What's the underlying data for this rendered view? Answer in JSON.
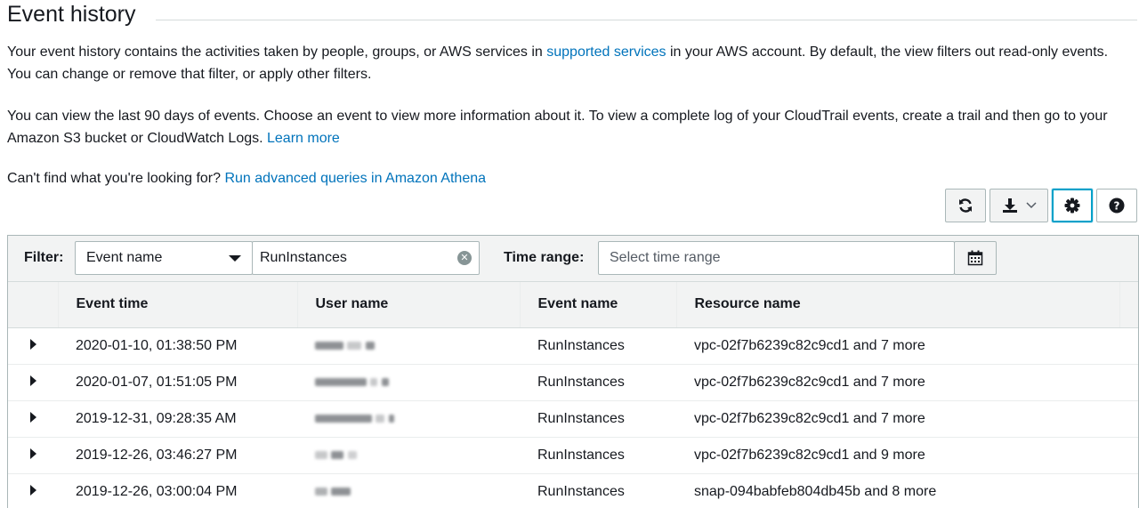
{
  "page": {
    "title": "Event history"
  },
  "intro": {
    "p1_a": "Your event history contains the activities taken by people, groups, or AWS services in ",
    "p1_link": "supported services",
    "p1_b": " in your AWS account. By default, the view filters out read-only events. You can change or remove that filter, or apply other filters.",
    "p2_a": "You can view the last 90 days of events. Choose an event to view more information about it. To view a complete log of your CloudTrail events, create a trail and then go to your Amazon S3 bucket or CloudWatch Logs. ",
    "p2_link": "Learn more",
    "p3_a": "Can't find what you're looking for? ",
    "p3_link": "Run advanced queries in Amazon Athena"
  },
  "toolbar": {
    "icons": [
      "refresh-icon",
      "download-icon",
      "gear-icon",
      "help-icon"
    ]
  },
  "filter": {
    "label": "Filter:",
    "attribute": "Event name",
    "value": "RunInstances",
    "time_label": "Time range:",
    "time_placeholder": "Select time range"
  },
  "table": {
    "columns": [
      "Event time",
      "User name",
      "Event name",
      "Resource name"
    ],
    "rows": [
      {
        "time": "2020-01-10, 01:38:50 PM",
        "event": "RunInstances",
        "resource": "vpc-02f7b6239c82c9cd1 and 7 more"
      },
      {
        "time": "2020-01-07, 01:51:05 PM",
        "event": "RunInstances",
        "resource": "vpc-02f7b6239c82c9cd1 and 7 more"
      },
      {
        "time": "2019-12-31, 09:28:35 AM",
        "event": "RunInstances",
        "resource": "vpc-02f7b6239c82c9cd1 and 7 more"
      },
      {
        "time": "2019-12-26, 03:46:27 PM",
        "event": "RunInstances",
        "resource": "vpc-02f7b6239c82c9cd1 and 9 more"
      },
      {
        "time": "2019-12-26, 03:00:04 PM",
        "event": "RunInstances",
        "resource": "snap-094babfeb804db45b and 8 more"
      }
    ]
  },
  "colors": {
    "link": "#0073bb",
    "focus": "#00a1c9"
  }
}
